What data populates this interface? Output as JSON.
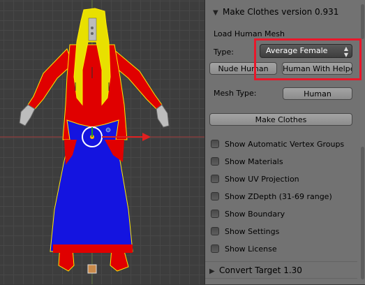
{
  "viewport": {
    "model": "female-human-mesh"
  },
  "panel": {
    "make_clothes": {
      "title": "Make Clothes version 0.931",
      "load_human_mesh_label": "Load Human Mesh",
      "type_label": "Type:",
      "type_value": "Average Female",
      "nude_human_button": "Nude Human",
      "human_with_helpers_button": "Human With Helpe",
      "mesh_type_label": "Mesh Type:",
      "mesh_type_value": "Human",
      "make_clothes_button": "Make Clothes",
      "checkboxes": [
        {
          "label": "Show Automatic Vertex Groups",
          "checked": false
        },
        {
          "label": "Show Materials",
          "checked": false
        },
        {
          "label": "Show UV Projection",
          "checked": false
        },
        {
          "label": "Show ZDepth (31-69 range)",
          "checked": false
        },
        {
          "label": "Show Boundary",
          "checked": false
        },
        {
          "label": "Show Settings",
          "checked": false
        },
        {
          "label": "Show License",
          "checked": false
        }
      ]
    },
    "convert_target": {
      "title": "Convert Target 1.30"
    }
  },
  "colors": {
    "highlight": "#e8182b",
    "mesh_red": "#e00000",
    "mesh_blue": "#1414e0",
    "mesh_yellow": "#e8e000",
    "axis_red": "#e02020"
  }
}
